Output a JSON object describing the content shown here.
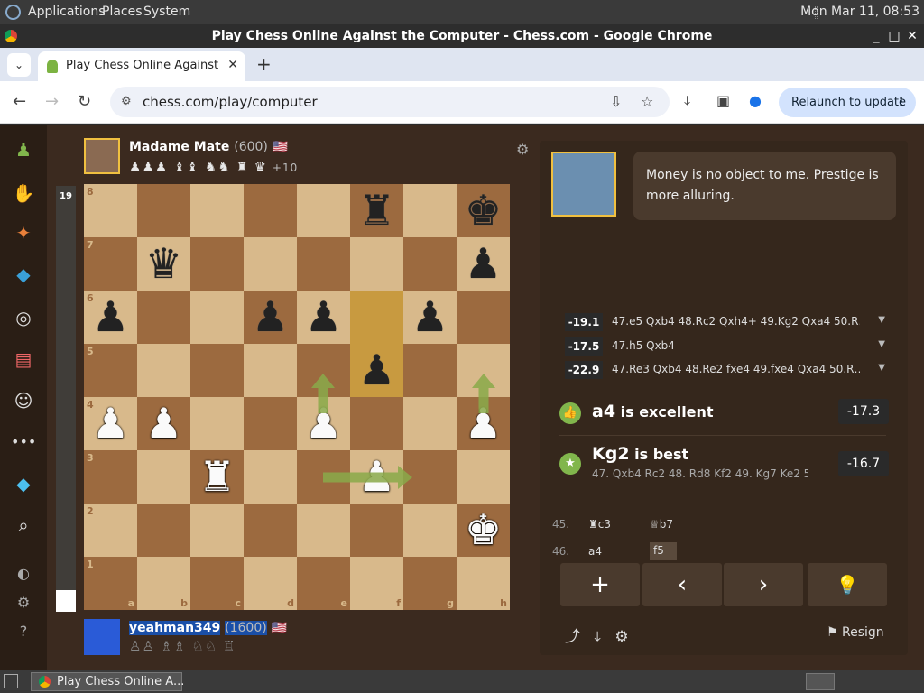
{
  "os_panel": {
    "menus": [
      "Applications",
      "Places",
      "System"
    ],
    "clock": "Mon Mar 11, 08:53"
  },
  "window": {
    "title": "Play Chess Online Against the Computer - Chess.com - Google Chrome",
    "controls": [
      "_",
      "□",
      "✕"
    ]
  },
  "tabs": [
    {
      "label": "Play Chess Online Against the Computer - Chess.com",
      "close": "✕"
    }
  ],
  "tab_list_icon": "⌄",
  "new_tab": "+",
  "address_bar": {
    "url": "chess.com/play/computer",
    "relaunch_label": "Relaunch to update",
    "relaunch_menu": "⋮"
  },
  "sidebar_icons": [
    "pawn-icon",
    "hand-icon",
    "puzzle-icon",
    "learn-icon",
    "watch-icon",
    "news-icon",
    "social-icon",
    "more-icon",
    "diamond-icon",
    "search-icon",
    "theme-icon",
    "settings-icon",
    "help-icon"
  ],
  "eval_bar": {
    "value": "19"
  },
  "opponent": {
    "name": "Madame Mate",
    "rating": "(600)",
    "flag": "🇺🇸",
    "captured": "♟♟♟ ♝♝ ♞♞ ♜ ♛",
    "advantage": "+10"
  },
  "player": {
    "name": "yeahman349",
    "rating": "(1600)",
    "flag": "🇺🇸",
    "captured": "♙♙ ♗♗ ♘♘ ♖"
  },
  "board": {
    "files": [
      "a",
      "b",
      "c",
      "d",
      "e",
      "f",
      "g",
      "h"
    ],
    "ranks": [
      "8",
      "7",
      "6",
      "5",
      "4",
      "3",
      "2",
      "1"
    ],
    "pieces": {
      "f8": "br",
      "h8": "bk",
      "b7": "bq",
      "h7": "bp",
      "a6": "bp",
      "d6": "bp",
      "e6": "bp",
      "g6": "bp",
      "f5": "bp",
      "a4": "wp",
      "b4": "wp",
      "e4": "wp",
      "h4": "wp",
      "c3": "wr",
      "f3": "wp",
      "h2": "wk"
    },
    "highlight": [
      "f6",
      "f5"
    ]
  },
  "coach": {
    "message": "Money is no object to me. Prestige is more alluring."
  },
  "engine_lines": [
    {
      "score": "-19.1",
      "moves": "47.e5 Qxb4 48.Rc2 Qxh4+ 49.Kg2 Qxa4 50.R…"
    },
    {
      "score": "-17.5",
      "moves": "47.h5 Qxb4"
    },
    {
      "score": "-22.9",
      "moves": "47.Re3 Qxb4 48.Re2 fxe4 49.fxe4 Qxa4 50.R…"
    }
  ],
  "verdicts": {
    "excellent": {
      "move": "a4",
      "text": "is excellent",
      "score": "-17.3"
    },
    "best": {
      "move": "Kg2",
      "text": "is best",
      "score": "-16.7",
      "line": "47. Qxb4 Rc2 48. Rd8 Kf2 49. Kg7 Ke2 50. Q…"
    }
  },
  "move_list": [
    {
      "num": "45.",
      "white": "c3",
      "white_piece": "♜",
      "black": "b7",
      "black_piece": "♕"
    },
    {
      "num": "46.",
      "white": "a4",
      "white_piece": "",
      "black": "f5",
      "black_piece": ""
    }
  ],
  "controls": {
    "add": "+",
    "prev": "‹",
    "next": "›",
    "hint": "💡"
  },
  "resign_label": "Resign",
  "taskbar": {
    "task_label": "Play Chess Online A..."
  },
  "colors": {
    "light_square": "#d8b98b",
    "dark_square": "#9c6a3f",
    "highlight": "#c89a40",
    "arrow": "#8aaa4a"
  }
}
